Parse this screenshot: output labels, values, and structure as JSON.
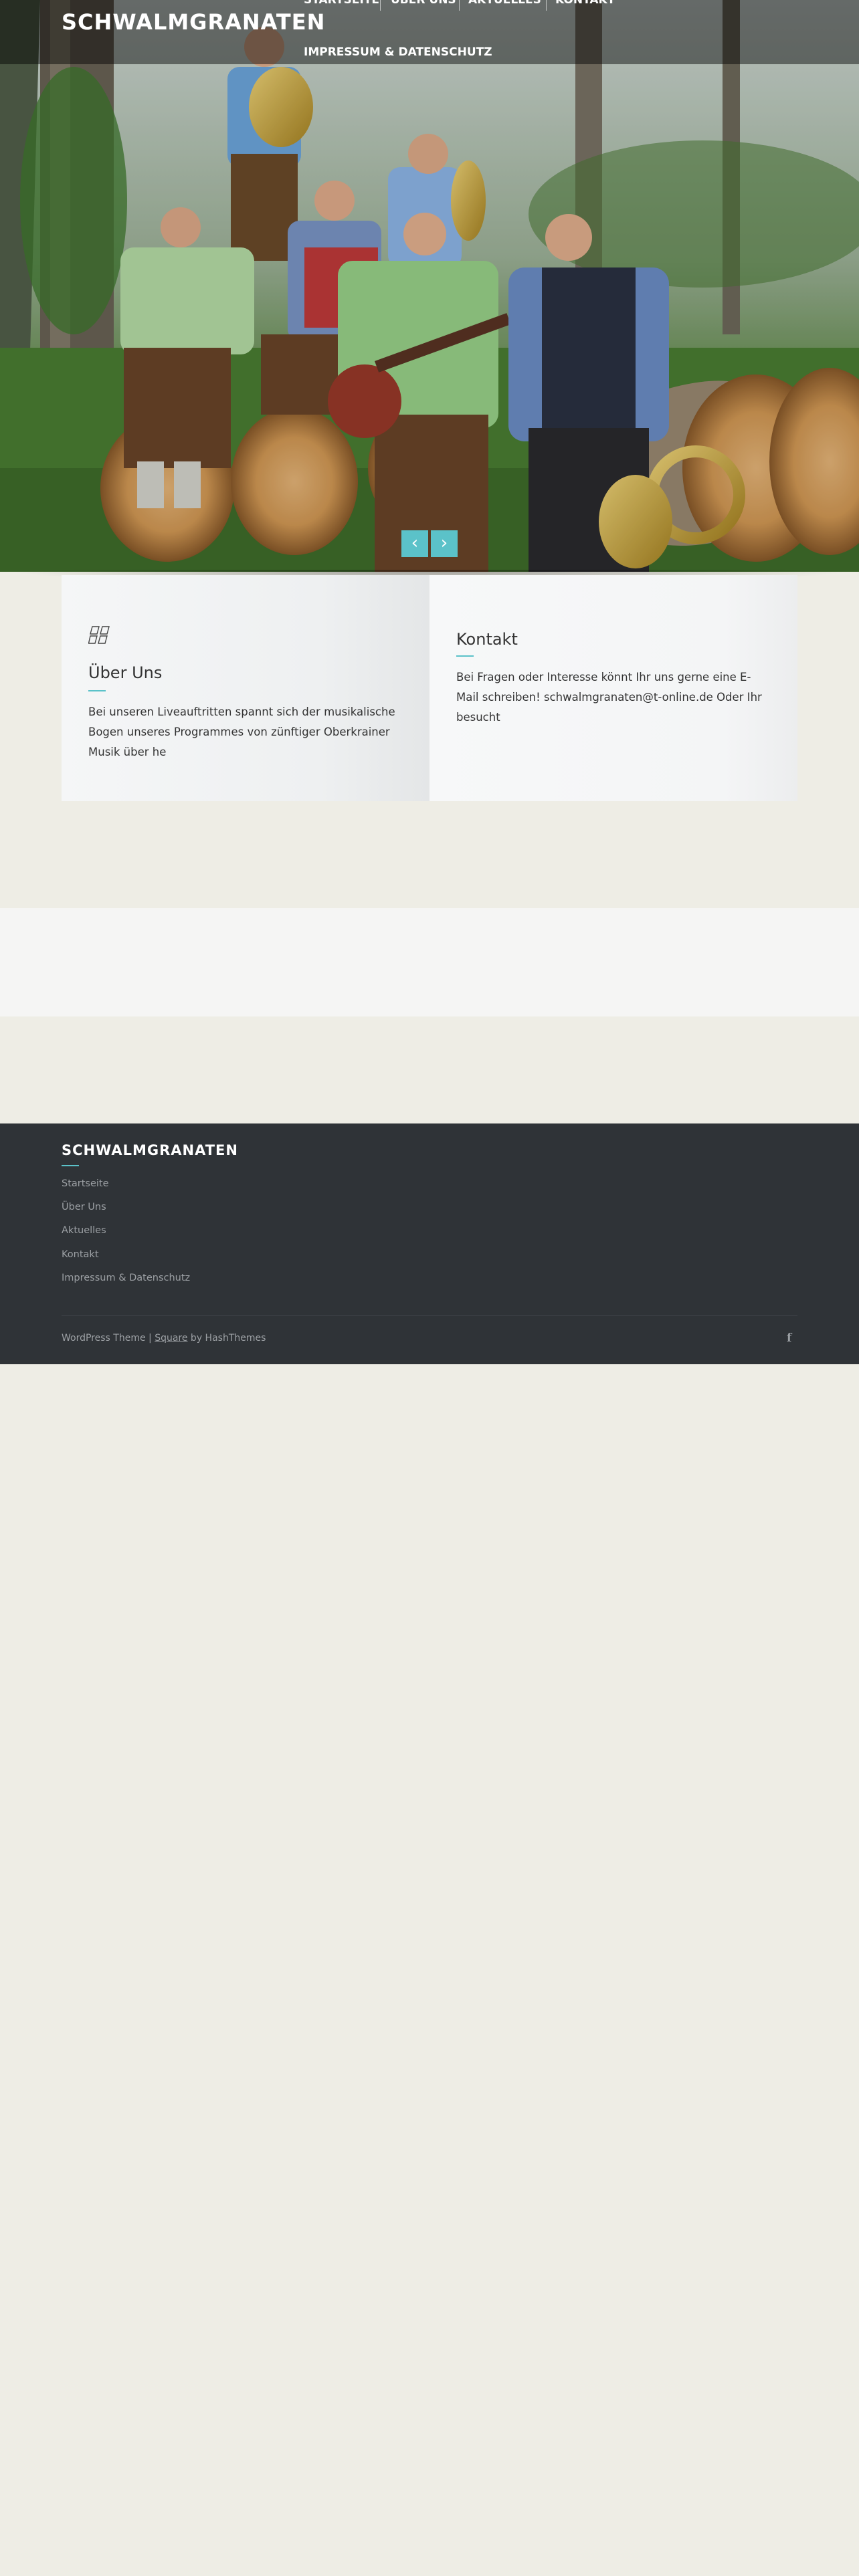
{
  "site": {
    "title": "SCHWALMGRANATEN"
  },
  "nav": {
    "items": [
      {
        "label": "STARTSEITE"
      },
      {
        "label": "ÜBER UNS"
      },
      {
        "label": "AKTUELLES"
      },
      {
        "label": "KONTAKT"
      },
      {
        "label": "IMPRESSUM & DATENSCHUTZ"
      }
    ]
  },
  "slider": {
    "prev_icon": "chevron-left-icon",
    "next_icon": "chevron-right-icon",
    "prev_glyph": "‹",
    "next_glyph": "›"
  },
  "features": [
    {
      "icon": "grid-icon",
      "title": "Über Uns",
      "text": "Bei unseren Liveauftritten spannt sich der musikalische Bogen unseres Programmes von zünftiger Oberkrainer Musik über he"
    },
    {
      "title": "Kontakt",
      "text": "Bei Fragen oder Interesse könnt Ihr uns gerne eine E-Mail schreiben! schwalmgranaten@t-online.de Oder Ihr besucht"
    }
  ],
  "footer": {
    "title": "SCHWALMGRANATEN",
    "links": [
      {
        "label": "Startseite"
      },
      {
        "label": "Über Uns"
      },
      {
        "label": "Aktuelles"
      },
      {
        "label": "Kontakt"
      },
      {
        "label": "Impressum & Datenschutz"
      }
    ],
    "credits_prefix": "WordPress Theme | ",
    "credits_link": "Square",
    "credits_suffix": " by HashThemes",
    "social_icon": "facebook-icon",
    "social_glyph": "f"
  },
  "colors": {
    "accent": "#5bc2c9",
    "page_bg": "#eeede5",
    "footer_bg": "#2f3337",
    "header_overlay": "rgba(0,0,0,0.45)"
  }
}
